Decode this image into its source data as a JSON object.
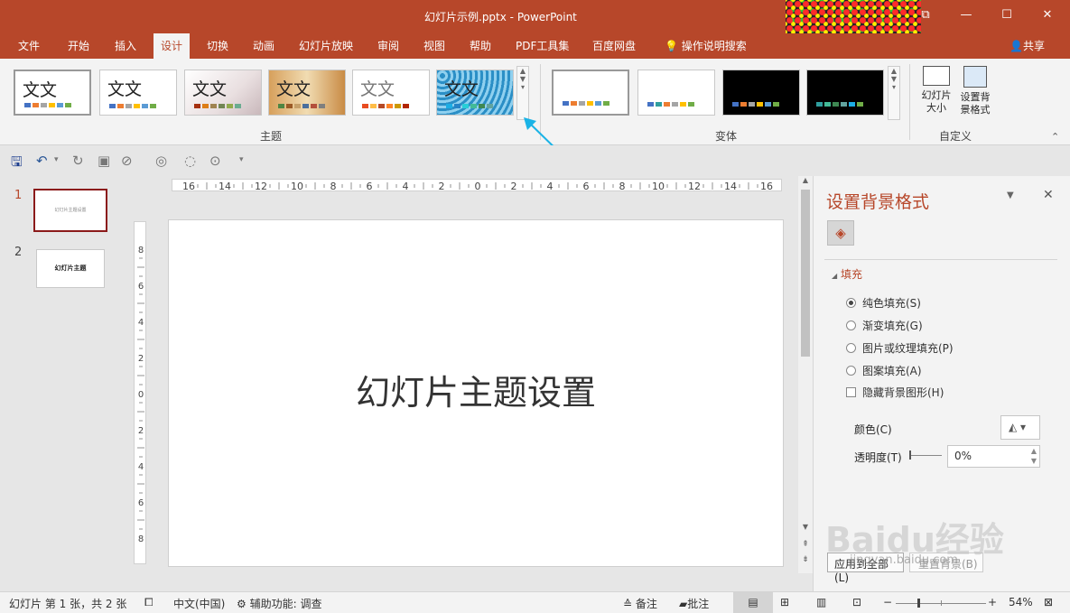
{
  "window": {
    "title": "幻灯片示例.pptx  -  PowerPoint"
  },
  "tabs": [
    "文件",
    "开始",
    "插入",
    "设计",
    "切换",
    "动画",
    "幻灯片放映",
    "审阅",
    "视图",
    "帮助",
    "PDF工具集",
    "百度网盘"
  ],
  "active_tab": "设计",
  "tell_me": "操作说明搜索",
  "share": "共享",
  "ribbon": {
    "themes_label": "主题",
    "theme_sample_text": "文文",
    "variants_label": "变体",
    "customize_label": "自定义",
    "slide_size": "幻灯片大小",
    "format_background": "设置背景格式"
  },
  "colors": {
    "accent": "#b7472a",
    "arrow": "#1ab3e6"
  },
  "thumbnails": [
    {
      "number": "1",
      "text": "幻灯片主题设置"
    },
    {
      "number": "2",
      "text": "幻灯片主题"
    }
  ],
  "slide": {
    "title": "幻灯片主题设置"
  },
  "hruler_labels": [
    "16",
    "14",
    "12",
    "10",
    "8",
    "6",
    "4",
    "2",
    "0",
    "2",
    "4",
    "6",
    "8",
    "10",
    "12",
    "14",
    "16"
  ],
  "vruler_labels": [
    "8",
    "6",
    "4",
    "2",
    "0",
    "2",
    "4",
    "6",
    "8"
  ],
  "pane": {
    "title": "设置背景格式",
    "fill_section": "填充",
    "options": [
      {
        "label": "纯色填充(S)",
        "selected": true
      },
      {
        "label": "渐变填充(G)",
        "selected": false
      },
      {
        "label": "图片或纹理填充(P)",
        "selected": false
      },
      {
        "label": "图案填充(A)",
        "selected": false
      }
    ],
    "hide_bg": "隐藏背景图形(H)",
    "color_label": "颜色(C)",
    "transparency_label": "透明度(T)",
    "transparency_value": "0%",
    "apply_all": "应用到全部(L)",
    "reset_bg": "重置背景(B)"
  },
  "status": {
    "slide_info": "幻灯片 第 1 张，共 2 张",
    "language": "中文(中国)",
    "accessibility": "辅助功能: 调查",
    "notes": "备注",
    "comments": "批注",
    "zoom": "54%"
  },
  "watermark": {
    "brand": "Baidu经验",
    "url": "jingyan.baidu.com"
  }
}
